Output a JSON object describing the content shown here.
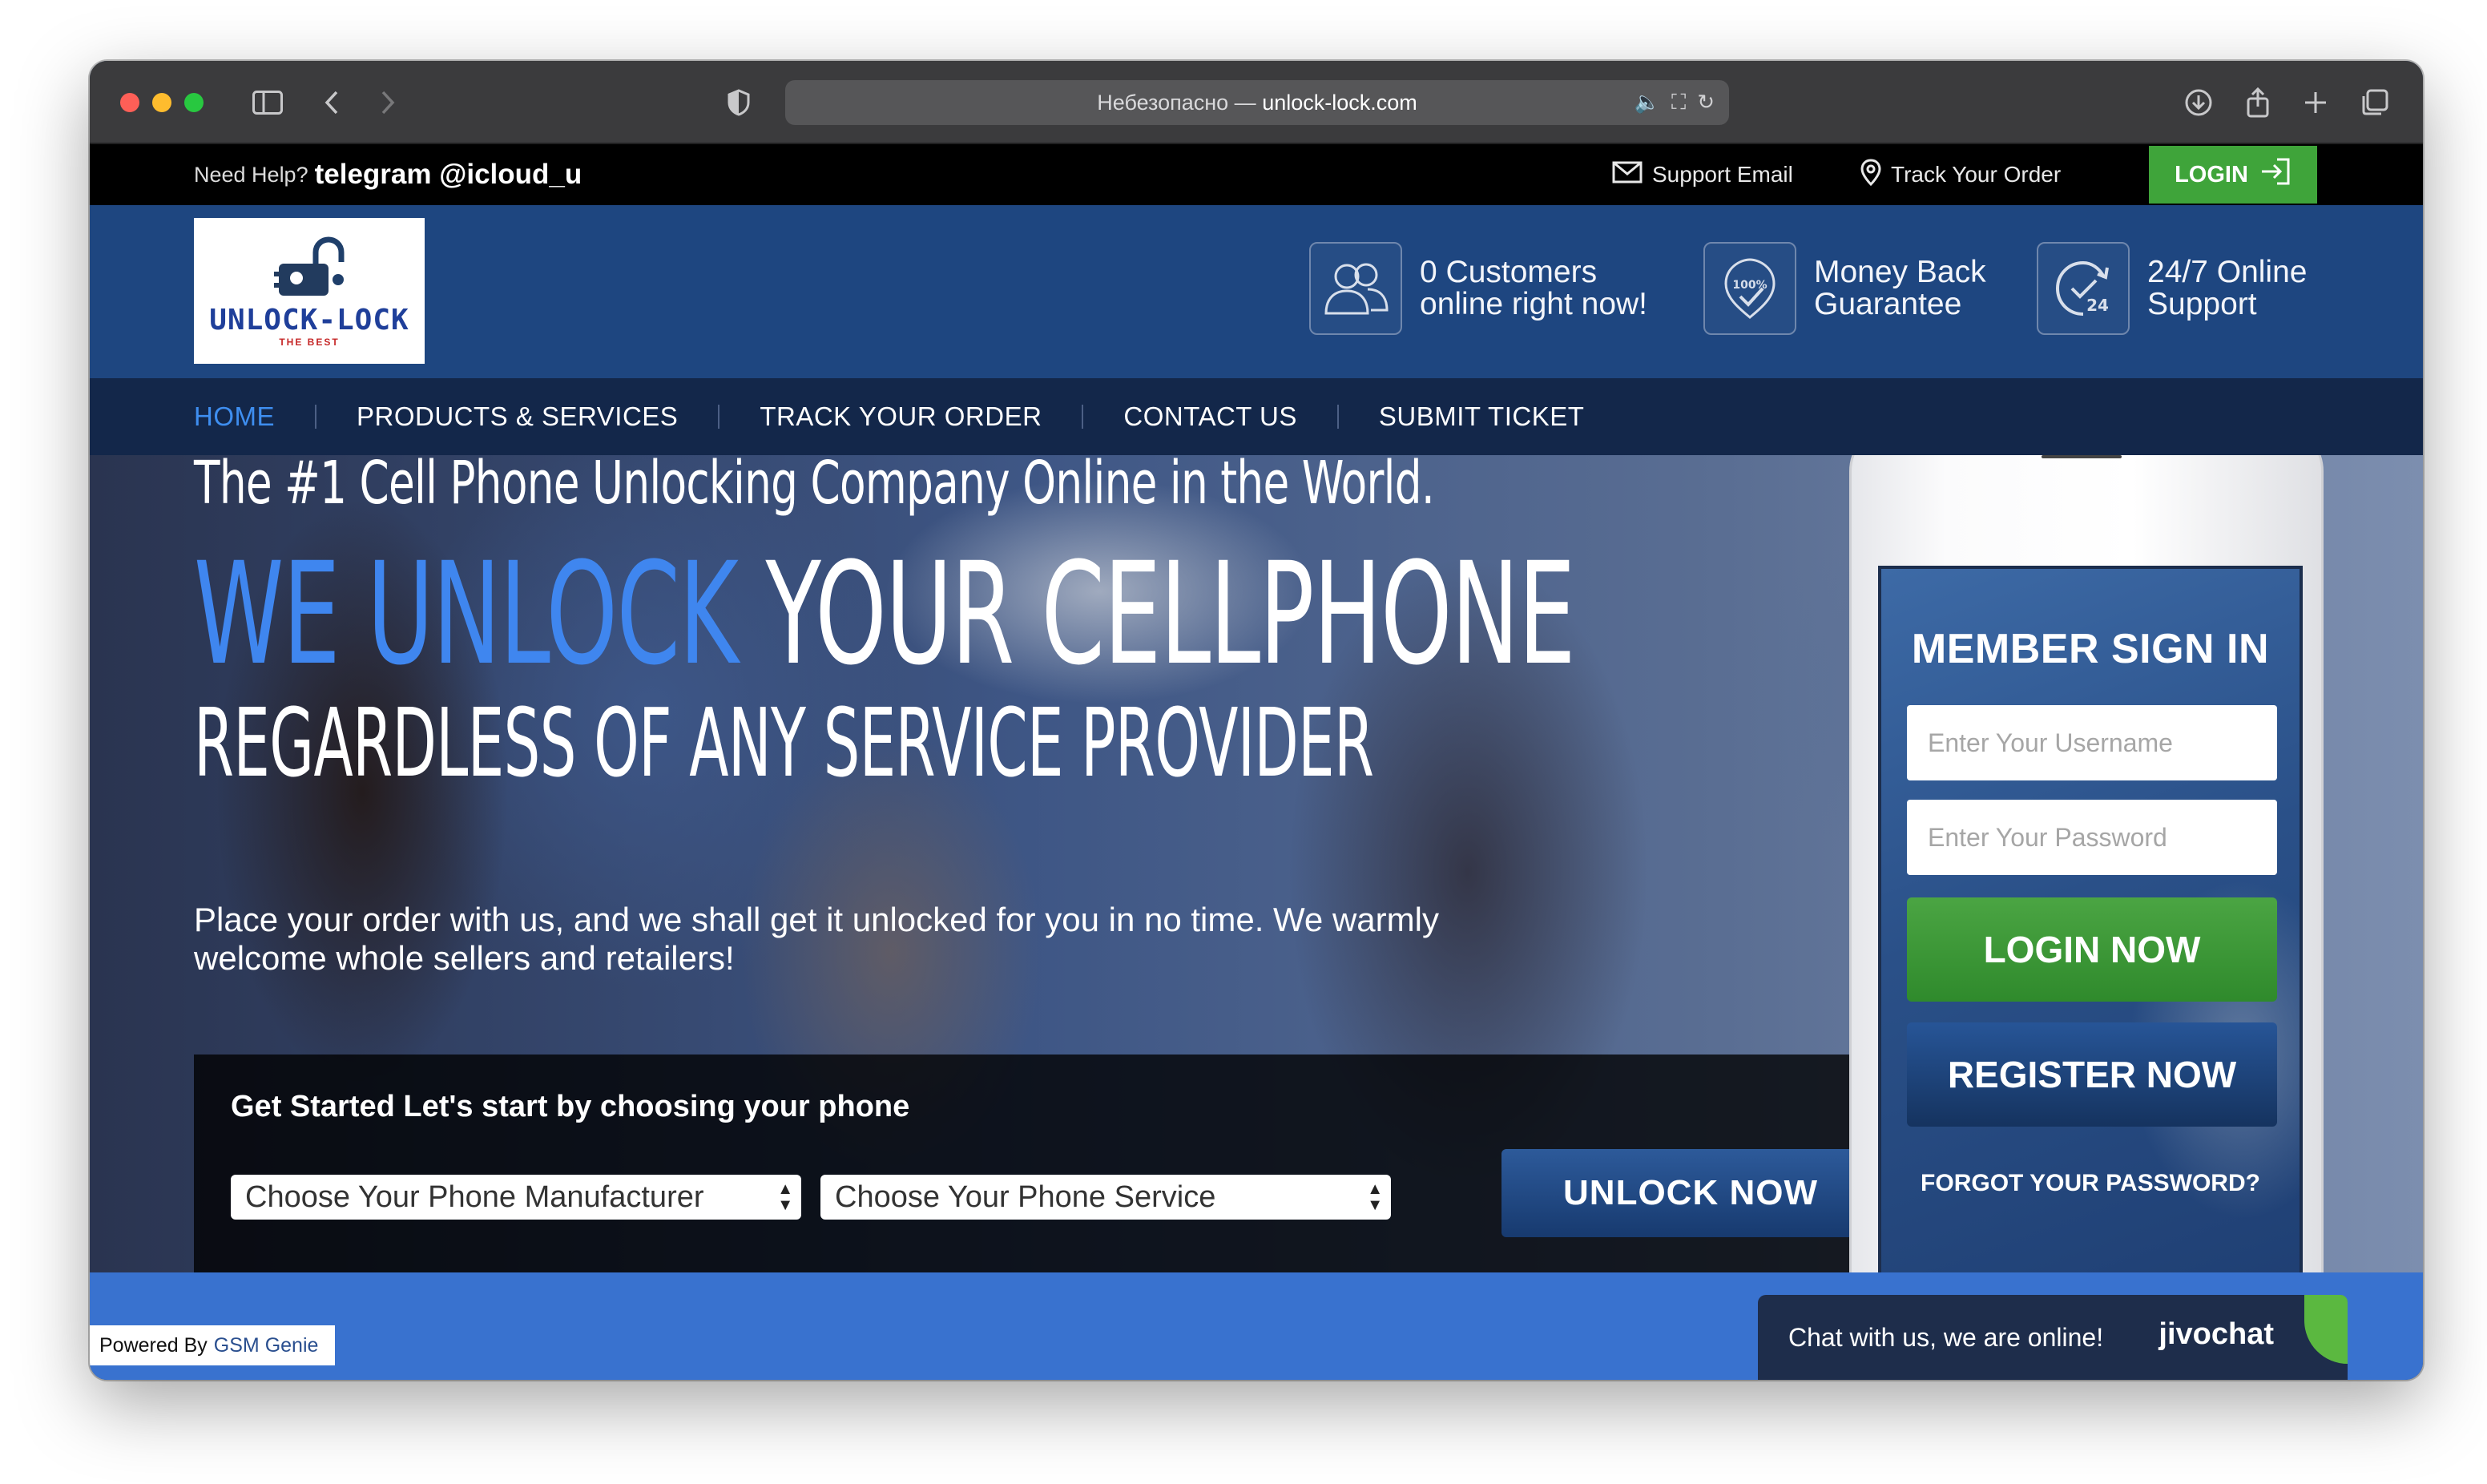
{
  "browser": {
    "url_prefix": "Небезопасно —",
    "url_host": "unlock-lock.com"
  },
  "topbar": {
    "help_label": "Need Help?",
    "help_value": "telegram @icloud_u",
    "support_email": "Support Email",
    "track_order": "Track Your Order",
    "login": "LOGIN"
  },
  "header": {
    "logo_text": "UNLOCK-LOCK",
    "logo_sub": "THE BEST",
    "features": [
      {
        "line1": "0 Customers",
        "line2": "online right now!",
        "icon": "users-icon"
      },
      {
        "line1": "Money Back",
        "line2": "Guarantee",
        "icon": "guarantee-badge-icon"
      },
      {
        "line1": "24/7 Online",
        "line2": "Support",
        "icon": "clock-24-icon"
      }
    ]
  },
  "nav": {
    "items": [
      "HOME",
      "PRODUCTS & SERVICES",
      "TRACK YOUR ORDER",
      "CONTACT US",
      "SUBMIT TICKET"
    ]
  },
  "hero": {
    "tagline": "The #1 Cell Phone Unlocking Company Online in the World.",
    "headline_blue": "WE UNLOCK",
    "headline_white": "YOUR CELLPHONE",
    "subheadline": "REGARDLESS OF ANY SERVICE PROVIDER",
    "description": "Place your order with us, and we shall get it unlocked for you in no time. We warmly welcome whole sellers and retailers!"
  },
  "picker": {
    "title": "Get Started Let's start by choosing your phone",
    "manufacturer_select": "Choose Your Phone Manufacturer",
    "service_select": "Choose Your Phone Service",
    "button": "UNLOCK NOW"
  },
  "signin": {
    "title": "MEMBER SIGN IN",
    "username_placeholder": "Enter Your Username",
    "password_placeholder": "Enter Your Password",
    "login_button": "LOGIN NOW",
    "register_button": "REGISTER NOW",
    "forgot": "FORGOT YOUR PASSWORD?"
  },
  "footer": {
    "powered_label": "Powered By",
    "powered_name": "GSM Genie"
  },
  "chat": {
    "text": "Chat with us, we are online!",
    "brand": "jivochat"
  },
  "colors": {
    "header_blue": "#1e4680",
    "nav_dark": "#13274a",
    "accent_blue": "#3f86ef",
    "green": "#3fa43a"
  }
}
